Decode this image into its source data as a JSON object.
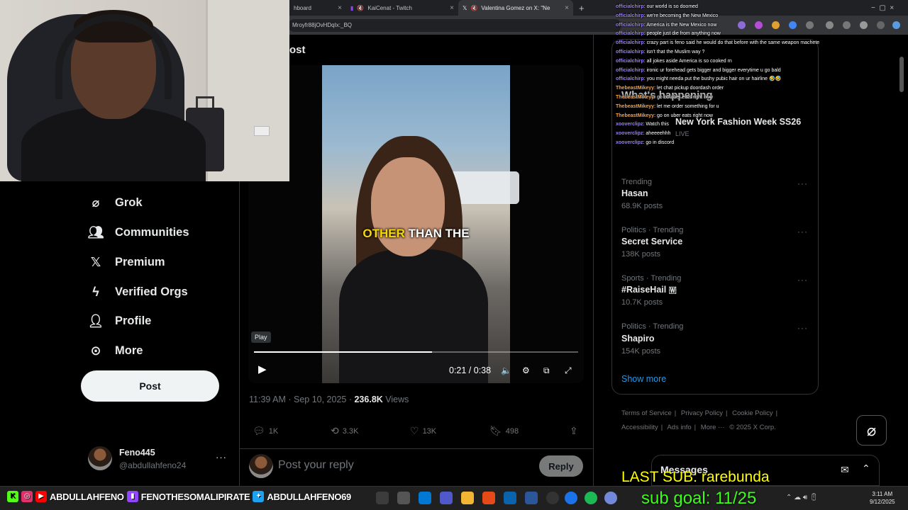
{
  "browser": {
    "tabs": [
      {
        "label": "hboard"
      },
      {
        "label": "KaiCenat - Twitch"
      },
      {
        "label": "Valentina Gomez on X: \"Ne"
      }
    ],
    "url": "Mroyfr88jOvHDqIx:_BQ"
  },
  "nav": {
    "items": [
      {
        "label": "Grok",
        "icon": "grok-icon"
      },
      {
        "label": "Communities",
        "icon": "communities-icon"
      },
      {
        "label": "Premium",
        "icon": "x-logo-icon"
      },
      {
        "label": "Verified Orgs",
        "icon": "lightning-icon"
      },
      {
        "label": "Profile",
        "icon": "person-icon"
      },
      {
        "label": "More",
        "icon": "more-circle-icon"
      }
    ],
    "post_button": "Post",
    "account": {
      "name": "Feno445",
      "handle": "@abdullahfeno24"
    }
  },
  "post": {
    "header": "ost",
    "caption_highlight": "OTHER",
    "caption_rest": " THAN THE",
    "play_tooltip": "Play",
    "time": "0:21 / 0:38",
    "progress": 0.55,
    "timestamp": "11:39 AM · Sep 10, 2025 · ",
    "views_count": "236.8K",
    "views_label": " Views",
    "replies": "1K",
    "reposts": "3.3K",
    "likes": "13K",
    "bookmarks": "498",
    "reply_placeholder": "Post your reply",
    "reply_button": "Reply"
  },
  "sidebar": {
    "whats_happening": "What's happening",
    "event_title": "New York Fashion Week SS26",
    "event_status": "LIVE",
    "trends": [
      {
        "context": "Trending",
        "name": "Hasan",
        "count": "68.9K posts"
      },
      {
        "context": "Politics · Trending",
        "name": "Secret Service",
        "count": "138K posts"
      },
      {
        "context": "Sports · Trending",
        "name": "#RaiseHail 🇼",
        "count": "10.7K posts"
      },
      {
        "context": "Politics · Trending",
        "name": "Shapiro",
        "count": "154K posts"
      }
    ],
    "show_more": "Show more",
    "footer": [
      "Terms of Service",
      "|",
      "Privacy Policy",
      "|",
      "Cookie Policy",
      "|",
      "Accessibility",
      "|",
      "Ads info",
      "|",
      "More ···",
      "© 2025 X Corp."
    ],
    "messages": "Messages"
  },
  "chat": [
    {
      "user": "officialchirp",
      "msg": ": our world is so doomed",
      "style": "u"
    },
    {
      "user": "officialchirp",
      "msg": ": we're becoming the New Mexico",
      "style": "u"
    },
    {
      "user": "officialchirp",
      "msg": ": America is the New Mexico now",
      "style": "u"
    },
    {
      "user": "officialchirp",
      "msg": ": people just die from anything now",
      "style": "u"
    },
    {
      "user": "officialchirp",
      "msg": ": crazy part is feno said he would do that before with the same weapon machete",
      "style": "u"
    },
    {
      "user": "officialchirp",
      "msg": ": isn't that the Muslim way ?",
      "style": "u"
    },
    {
      "user": "officialchirp",
      "msg": ": all jokes aside America is so cooked rn",
      "style": "u"
    },
    {
      "user": "officialchirp",
      "msg": ": ironic ur forehead gets bigger and bigger everytime u go bald",
      "style": "u"
    },
    {
      "user": "officialchirp",
      "msg": ": you might needa put the bushy pubic hair on ur hairline 🤣🤣",
      "style": "u"
    },
    {
      "user": "ThebeastMikeyy",
      "msg": ": let chat pickup doordash order",
      "style": "u2"
    },
    {
      "user": "ThebeastMikeyy",
      "msg": ": go on uber eats right now",
      "style": "u2"
    },
    {
      "user": "ThebeastMikeyy",
      "msg": ": let me order something for u",
      "style": "u2"
    },
    {
      "user": "ThebeastMikeyy",
      "msg": ": go on uber eats right now",
      "style": "u2"
    },
    {
      "user": "xooverclipz",
      "msg": ": Watch this",
      "style": "u"
    },
    {
      "user": "xooverclipz",
      "msg": ": aheeeehhh",
      "style": "u"
    },
    {
      "user": "xooverclipz",
      "msg": ": go in discord",
      "style": "u"
    }
  ],
  "overlay": {
    "last_sub": "LAST SUB: rarebunda",
    "sub_goal": "sub goal: 11/25"
  },
  "socials": [
    "ABDULLAHFENO",
    "FENOTHESOMALIPIRATE",
    "ABDULLAHFENO69"
  ],
  "clock": {
    "time": "3:11 AM",
    "date": "9/12/2025"
  },
  "colors": {
    "accent": "#1d9bf0",
    "sub_last": "#ffff00",
    "sub_goal": "#39ff14"
  }
}
